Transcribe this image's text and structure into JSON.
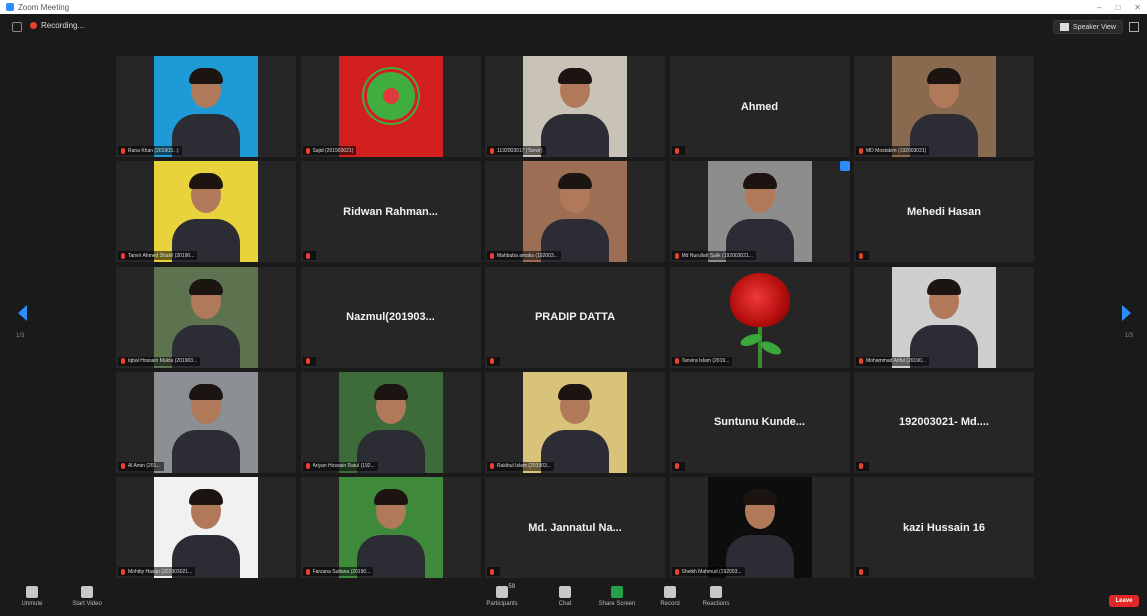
{
  "titlebar": {
    "title": "Zoom Meeting",
    "controls": [
      "–",
      "□",
      "✕"
    ]
  },
  "topbar": {
    "recording_label": "Recording...",
    "view_label": "Speaker View"
  },
  "colors": {
    "accent": "#2d8cff",
    "muted_mic": "#e8412c",
    "end": "#e02828",
    "tile_bg": "#262626"
  },
  "pagination": {
    "left": "1/3",
    "right": "1/3"
  },
  "participants": [
    {
      "label": "Rana Khan (201903...)",
      "kind": "photo",
      "bg": "#1e9ad6"
    },
    {
      "label": "Sajid (201903021)",
      "kind": "flag"
    },
    {
      "label": "1192003017 (Tanvir)",
      "kind": "photo",
      "bg": "#c9c3b7"
    },
    {
      "label": "",
      "center_name": "Ahmed",
      "kind": "name"
    },
    {
      "label": "MD Mostakim (192003021)",
      "kind": "photo",
      "bg": "#8a6a4e"
    },
    {
      "label": "Tanvir Ahmed Shakil (20190...",
      "kind": "photo",
      "bg": "#e9d33c"
    },
    {
      "label": "",
      "center_name": "Ridwan Rahman...",
      "kind": "name"
    },
    {
      "label": "Mahbuba amalia (192003...",
      "kind": "photo",
      "bg": "#9c6f55"
    },
    {
      "label": "Md Nurullah Salik (192003021...",
      "kind": "photo",
      "bg": "#8d8d8d",
      "selected": true
    },
    {
      "label": "",
      "center_name": "Mehedi Hasan",
      "kind": "name"
    },
    {
      "label": "Iqbal Hossain Mukta (201903...",
      "kind": "photo",
      "bg": "#5d7350"
    },
    {
      "label": "",
      "center_name": "Nazmul(201903...",
      "kind": "name"
    },
    {
      "label": "",
      "center_name": "PRADIP DATTA",
      "kind": "name"
    },
    {
      "label": "Tanvira Islam (2019...",
      "kind": "rose"
    },
    {
      "label": "Mohammad Ariful (20190...",
      "kind": "photo",
      "bg": "#cfcfcf"
    },
    {
      "label": "Al Amin (201...",
      "kind": "photo",
      "bg": "#8c8f93"
    },
    {
      "label": "Ariyan Hossain Ratul (192...",
      "kind": "photo",
      "bg": "#3e6b3a"
    },
    {
      "label": "Rakibul Islam (201903...",
      "kind": "photo",
      "bg": "#d9c27a"
    },
    {
      "label": "",
      "center_name": "Suntunu Kunde...",
      "kind": "name"
    },
    {
      "label": "",
      "center_name": "192003021- Md....",
      "kind": "name"
    },
    {
      "label": "Mohiby Hasan (201903021...",
      "kind": "photo",
      "bg": "#f1f1f1"
    },
    {
      "label": "Farzana Sultana (20190...",
      "kind": "photo",
      "bg": "#3f8a3a"
    },
    {
      "label": "",
      "center_name": "Md. Jannatul Na...",
      "kind": "name"
    },
    {
      "label": "Sheikh Mahmud (192003...",
      "kind": "photo",
      "bg": "#0d0d0d"
    },
    {
      "label": "",
      "center_name": "kazi Hussain 16",
      "kind": "name"
    }
  ],
  "toolbar": {
    "unmute": "Unmute",
    "start_video": "Start Video",
    "participants": "Participants",
    "participants_count": "59",
    "chat": "Chat",
    "share_screen": "Share Screen",
    "record": "Record",
    "reactions": "Reactions",
    "end": "Leave"
  }
}
